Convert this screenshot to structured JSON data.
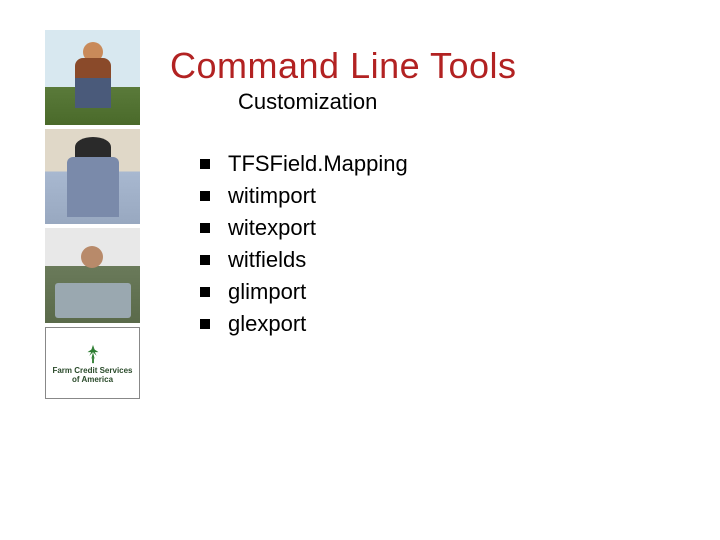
{
  "slide": {
    "title": "Command Line Tools",
    "subtitle": "Customization",
    "bullets": [
      "TFSField.Mapping",
      "witimport",
      "witexport",
      "witfields",
      "glimport",
      "glexport"
    ],
    "logo": {
      "line1": "Farm Credit Services",
      "line2": "of America"
    }
  }
}
